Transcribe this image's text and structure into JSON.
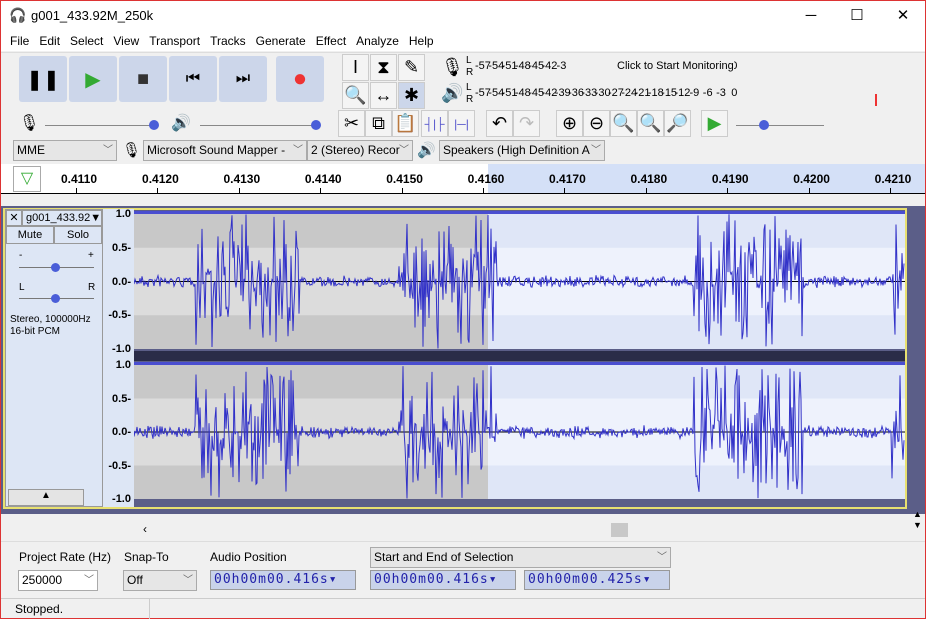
{
  "window": {
    "title": "g001_433.92M_250k",
    "minimize": "─",
    "maximize": "☐",
    "close": "✕"
  },
  "menu": [
    "File",
    "Edit",
    "Select",
    "View",
    "Transport",
    "Tracks",
    "Generate",
    "Effect",
    "Analyze",
    "Help"
  ],
  "transport": {
    "pause": "❚❚",
    "play": "▶",
    "stop": "■",
    "skip_start": "⏮",
    "skip_end": "⏭",
    "record": "●"
  },
  "meters": {
    "record_scale": [
      "-57",
      "-54",
      "-51",
      "-48",
      "-45",
      "-42",
      "-3",
      "",
      "",
      "",
      "",
      "",
      "!1",
      "-18",
      "-15",
      "-12",
      "-9",
      "-6",
      "-3",
      "0"
    ],
    "record_overlay": "Click to Start Monitoring",
    "playback_scale": [
      "-57",
      "-54",
      "-51",
      "-48",
      "-45",
      "-42",
      "-39",
      "-36",
      "-33",
      "-30",
      "-27",
      "-24",
      "-21",
      "-18",
      "-15",
      "-12",
      "-9",
      "-6",
      "-3",
      "0"
    ],
    "L": "L",
    "R": "R"
  },
  "device": {
    "host": "MME",
    "input": "Microsoft Sound Mapper -",
    "channels": "2 (Stereo) Recor",
    "output": "Speakers (High Definition A"
  },
  "ruler": {
    "labels": [
      "0.4110",
      "0.4120",
      "0.4130",
      "0.4140",
      "0.4150",
      "0.4160",
      "0.4170",
      "0.4180",
      "0.4190",
      "0.4200",
      "0.4210"
    ]
  },
  "track": {
    "name": "g001_433.92",
    "mute": "Mute",
    "solo": "Solo",
    "gain_minus": "-",
    "gain_plus": "+",
    "pan_l": "L",
    "pan_r": "R",
    "info1": "Stereo, 100000Hz",
    "info2": "16-bit PCM",
    "yticks": [
      "1.0",
      "0.5-",
      "0.0-",
      "-0.5-",
      "-1.0"
    ]
  },
  "colors": {
    "waveform": "#3232c8",
    "selection": "#eef2fc",
    "unselected": "#c8c8c8",
    "accent": "#5b5e88"
  },
  "selection_bar": {
    "rate_label": "Project Rate (Hz)",
    "rate": "250000",
    "snap_label": "Snap-To",
    "snap": "Off",
    "pos_label": "Audio Position",
    "position": "00h00m00.416s",
    "sel_mode": "Start and End of Selection",
    "start": "00h00m00.416s",
    "end": "00h00m00.425s"
  },
  "status": "Stopped."
}
